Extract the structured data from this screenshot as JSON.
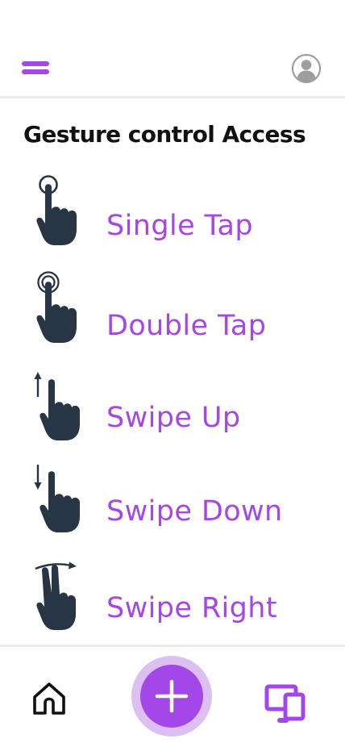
{
  "header": {
    "menu_icon": "hamburger-menu-icon",
    "profile_icon": "user-avatar-icon"
  },
  "main": {
    "title": "Gesture control Access",
    "gestures": [
      {
        "label": "Single Tap",
        "icon": "single-tap-gesture-icon"
      },
      {
        "label": "Double Tap",
        "icon": "double-tap-gesture-icon"
      },
      {
        "label": "Swipe Up",
        "icon": "swipe-up-gesture-icon"
      },
      {
        "label": "Swipe Down",
        "icon": "swipe-down-gesture-icon"
      },
      {
        "label": "Swipe Right",
        "icon": "swipe-right-gesture-icon"
      }
    ]
  },
  "bottom_nav": {
    "home_icon": "home-icon",
    "add_icon": "plus-icon",
    "devices_icon": "devices-icon"
  },
  "colors": {
    "accent": "#a347e8",
    "accent_light": "#dcc0f2",
    "icon_dark": "#283545",
    "title_text": "#111111",
    "divider": "#ebebeb"
  }
}
